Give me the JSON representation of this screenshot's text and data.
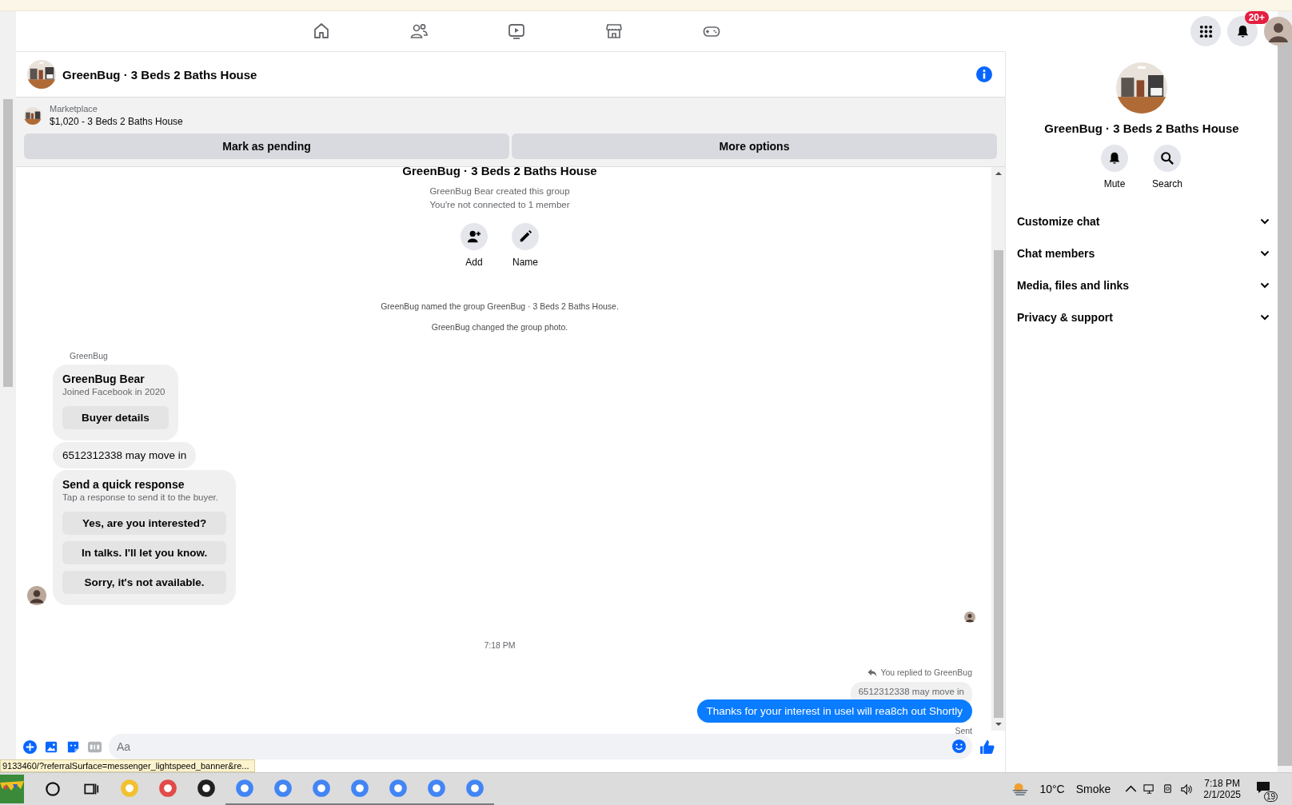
{
  "nav": {
    "notification_badge": "20+"
  },
  "chat": {
    "title": "GreenBug · 3 Beds 2 Baths House"
  },
  "marketplace": {
    "label": "Marketplace",
    "listing": "$1,020 - 3 Beds 2 Baths House",
    "buttons": [
      "Mark as pending",
      "More options"
    ]
  },
  "intro": {
    "title": "GreenBug · 3 Beds 2 Baths House",
    "lines": [
      "GreenBug Bear created this group",
      "You're not connected to 1 member"
    ],
    "actions": [
      {
        "kind": "add",
        "label": "Add"
      },
      {
        "kind": "name",
        "label": "Name"
      }
    ]
  },
  "events": [
    "GreenBug named the group GreenBug · 3 Beds 2 Baths House.",
    "GreenBug changed the group photo."
  ],
  "incoming": {
    "sender": "GreenBug",
    "messages": [
      {
        "kind": "profile",
        "title": "GreenBug Bear",
        "subtitle": "Joined Facebook in 2020",
        "buttons": [
          "Buyer details"
        ]
      },
      {
        "kind": "text",
        "text": "6512312338 may move in"
      },
      {
        "kind": "quick",
        "title": "Send a quick response",
        "subtitle": "Tap a response to send it to the buyer.",
        "buttons": [
          "Yes, are you interested?",
          "In talks. I'll let you know.",
          "Sorry, it's not available."
        ]
      }
    ]
  },
  "timestamp": "7:18 PM",
  "outgoing": {
    "reply_note": "You replied to GreenBug",
    "quoted": "6512312338 may move in",
    "text": "Thanks for your interest in usel will rea8ch out Shortly",
    "status": "Sent"
  },
  "composer": {
    "placeholder": "Aa"
  },
  "status_url": "9133460/?referralSurface=messenger_lightspeed_banner&re...",
  "details": {
    "title": "GreenBug · 3 Beds 2 Baths House",
    "actions": [
      {
        "kind": "mute",
        "label": "Mute"
      },
      {
        "kind": "search",
        "label": "Search"
      }
    ],
    "sections": [
      "Customize chat",
      "Chat members",
      "Media, files and links",
      "Privacy & support"
    ]
  },
  "taskbar": {
    "temperature": "10°C",
    "weather": "Smoke",
    "time": "7:18 PM",
    "date": "2/1/2025",
    "notifications": "19"
  }
}
